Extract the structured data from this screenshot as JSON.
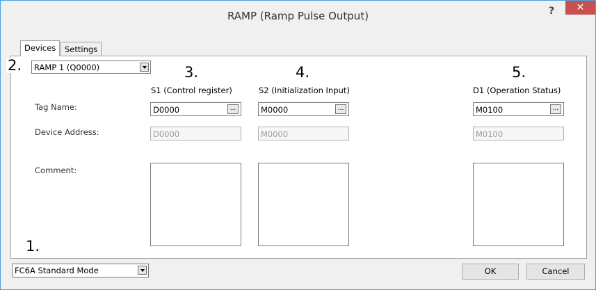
{
  "window": {
    "title": "RAMP (Ramp Pulse Output)",
    "help": "?",
    "close": "✕"
  },
  "tabs": [
    "Devices",
    "Settings"
  ],
  "markers": [
    "1.",
    "2.",
    "3.",
    "4.",
    "5."
  ],
  "instance_select": {
    "value": "RAMP 1 (Q0000)"
  },
  "row_labels": {
    "tag_name": "Tag Name:",
    "device_address": "Device Address:",
    "comment": "Comment:"
  },
  "columns": [
    {
      "header": "S1 (Control register)",
      "tag": "D0000",
      "address": "D0000",
      "button": "..."
    },
    {
      "header": "S2 (Initialization Input)",
      "tag": "M0000",
      "address": "M0000",
      "button": "..."
    },
    {
      "header": "D1 (Operation Status)",
      "tag": "M0100",
      "address": "M0100",
      "button": "..."
    }
  ],
  "mode_select": {
    "value": "FC6A Standard Mode"
  },
  "buttons": {
    "ok": "OK",
    "cancel": "Cancel"
  },
  "colors": {
    "close_bg": "#c75050",
    "window_border": "#4aa3df",
    "dialog_bg": "#f0f0f0"
  }
}
